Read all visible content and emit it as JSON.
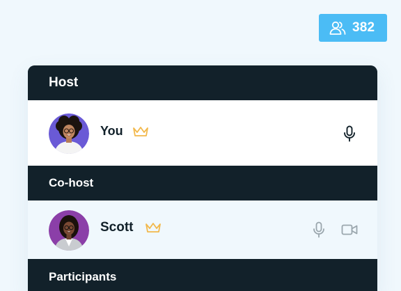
{
  "participants_count": {
    "icon": "users-icon",
    "value": "382"
  },
  "sections": {
    "host": {
      "title": "Host",
      "member": {
        "name": "You",
        "role_icon": "crown-icon",
        "controls": [
          "microphone-icon"
        ]
      }
    },
    "cohost": {
      "title": "Co-host",
      "member": {
        "name": "Scott",
        "role_icon": "crown-icon",
        "controls": [
          "microphone-icon",
          "video-camera-icon"
        ]
      }
    },
    "participants": {
      "title": "Participants"
    }
  },
  "colors": {
    "background": "#f0f8fd",
    "badge": "#4bbcf5",
    "header": "#12212a",
    "crown": "#f2b84b",
    "avatar_host_bg": "#6a5ad6",
    "avatar_cohost_bg": "#8b3fa8",
    "muted_icon": "#9aa6ad",
    "active_icon": "#12212a"
  }
}
